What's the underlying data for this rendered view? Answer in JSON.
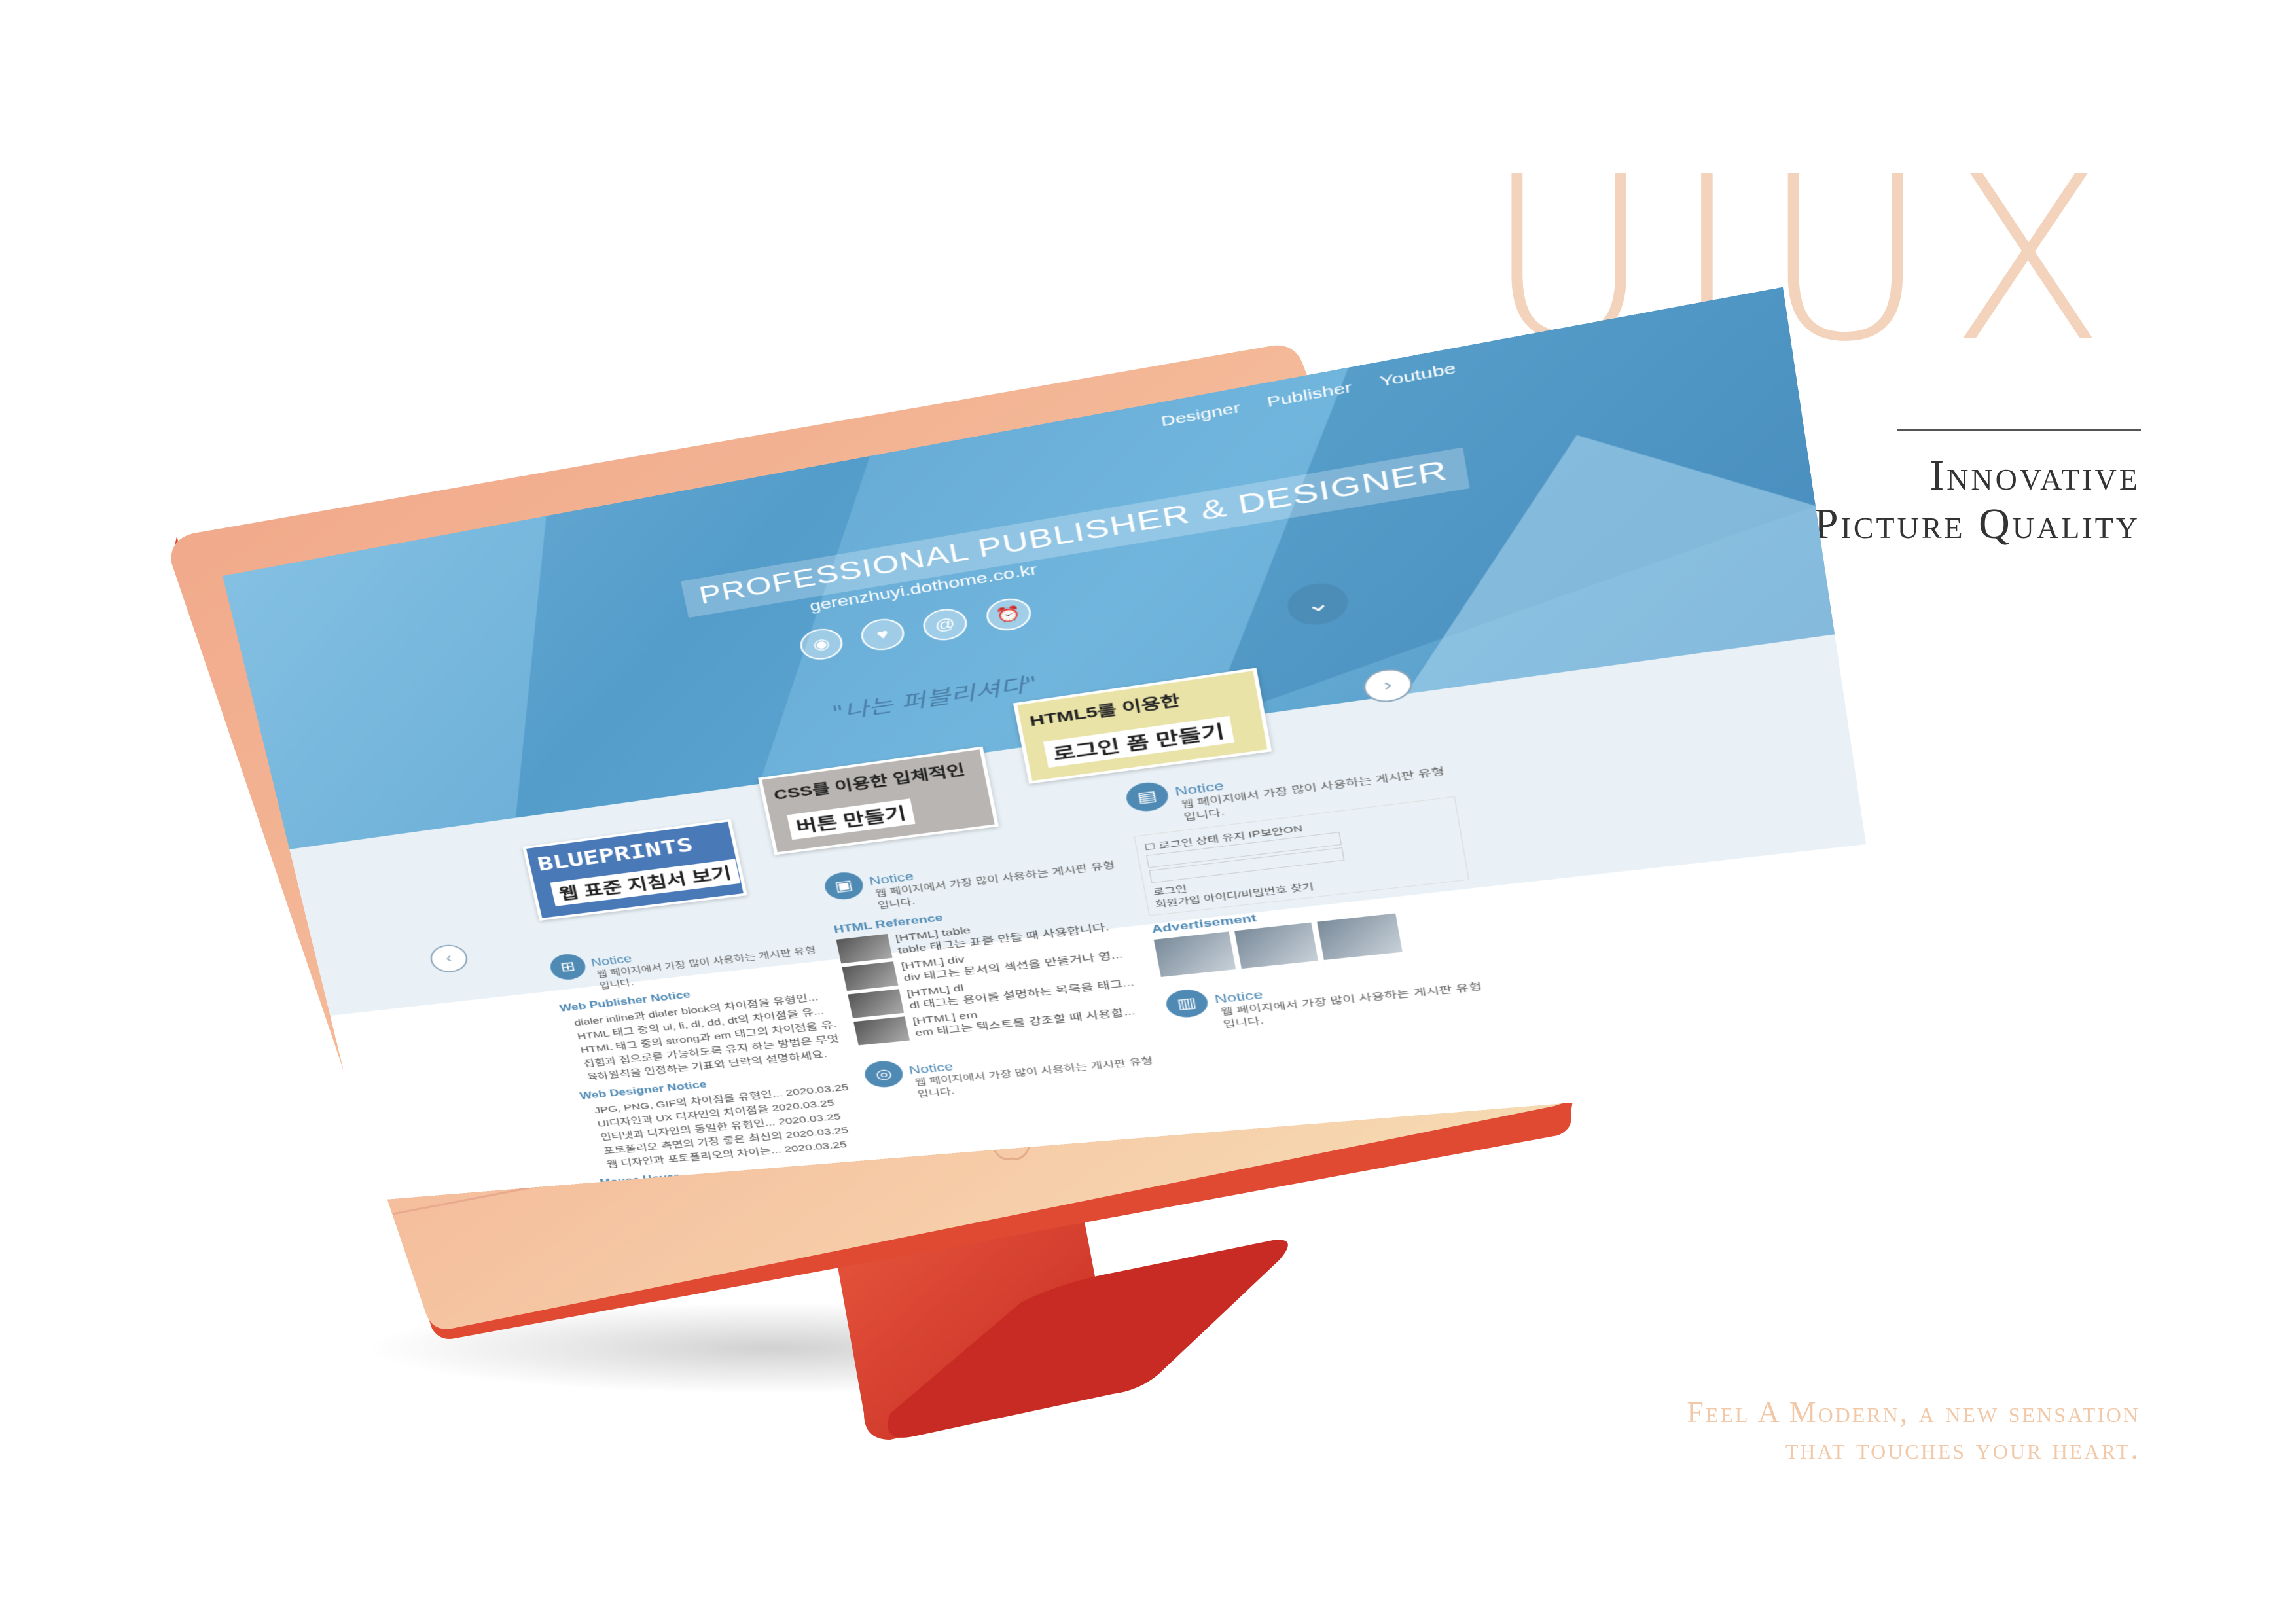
{
  "hero": {
    "title": "UIUX",
    "tagline_line1": "Innovative",
    "tagline_line2": "Picture Quality"
  },
  "slogan": {
    "line1": "Feel A Modern, a new sensation",
    "line2": "that touches your heart."
  },
  "colors": {
    "accent_peach": "#f3d3bb",
    "monitor_body": "#f2a98a",
    "monitor_stand": "#d83a28",
    "screen_blue": "#5aa3cf"
  },
  "screen": {
    "nav": [
      "Designer",
      "Publisher",
      "Youtube"
    ],
    "header_title": "PROFESSIONAL PUBLISHER & DESIGNER",
    "header_url": "gerenzhuyi.dothome.co.kr",
    "motto": "\"나는 퍼블리셔다\"",
    "cards": [
      {
        "top": "BLUEPRINTS",
        "bottom": "웹 표준 지침서 보기"
      },
      {
        "top": "CSS를 이용한 입체적인",
        "bottom": "버튼 만들기"
      },
      {
        "top": "HTML5를 이용한",
        "bottom": "로그인 폼 만들기"
      }
    ],
    "notice_label": "Notice",
    "notice_desc": "웹 페이지에서 가장 많이 사용하는 게시판 유형입니다.",
    "col_a": {
      "h1": "Web Publisher Notice",
      "items1": [
        "dialer inline과 dialer block의 차이점을 유형인...",
        "HTML 태그 중의 ul, li, dl, dd, dt의 차이점을 유...",
        "HTML 태그 중의 strong과 em 태그의 차이점을 유...",
        "접힘과 집으로를 가능하도록 유지 하는 방법은 무엇인가요?",
        "육하원칙을 인정하는 기표와 단락의 설명하세요."
      ],
      "h2": "Web Designer Notice",
      "items2": [
        "JPG, PNG, GIF의 차이점을 유형인...",
        "UI디자인과 UX 디자인의 차이점을",
        "인터넷과 디자인의 동일한 유형인...",
        "포토폴리오 측면의 가장 좋은 최신의",
        "웹 디자인과 포토폴리오의 차이는..."
      ],
      "dates": [
        "2020.03.25",
        "2020.03.25",
        "2020.03.25",
        "2020.03.25",
        "2020.03.25"
      ],
      "footer": "Mouse Hover"
    },
    "col_b": {
      "h1": "HTML Reference",
      "refs": [
        {
          "title": "[HTML] table",
          "desc": "table 태그는 표를 만들 때 사용합니다."
        },
        {
          "title": "[HTML] div",
          "desc": "div 태그는 문서의 섹션을 만들거나 영..."
        },
        {
          "title": "[HTML] dl",
          "desc": "dl 태그는 용어를 설명하는 목록을 태그..."
        },
        {
          "title": "[HTML] em",
          "desc": "em 태그는 텍스트를 강조할 때 사용합..."
        }
      ]
    },
    "col_c": {
      "login_remember": "로그인 상태 유지",
      "login_keep": "IP보안ON",
      "login_button": "로그인",
      "login_links": "회원가입  아이디/비밀번호 찾기",
      "ad_label": "Advertisement"
    }
  }
}
